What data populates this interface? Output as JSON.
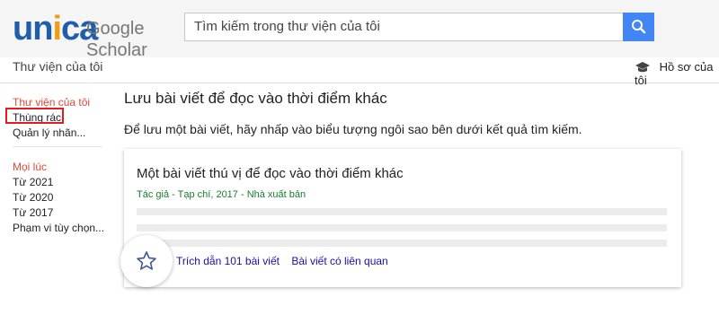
{
  "header": {
    "brand_unica": "unica",
    "brand_scholar": "Google Scholar",
    "search_placeholder": "Tìm kiếm trong thư viện của tôi"
  },
  "subheader": {
    "title": "Thư viện của tôi",
    "profile_label": "Hồ sơ của tôi"
  },
  "sidebar": {
    "library_items": [
      {
        "label": "Thư viện của tôi",
        "active": true
      },
      {
        "label": "Thùng rác",
        "highlighted": true
      },
      {
        "label": "Quản lý nhãn..."
      }
    ],
    "time_items": [
      {
        "label": "Mọi lúc",
        "active": true
      },
      {
        "label": "Từ 2021"
      },
      {
        "label": "Từ 2020"
      },
      {
        "label": "Từ 2017"
      },
      {
        "label": "Phạm vi tùy chọn..."
      }
    ]
  },
  "main": {
    "heading": "Lưu bài viết để đọc vào thời điểm khác",
    "description": "Để lưu một bài viết, hãy nhấp vào biểu tượng ngôi sao bên dưới kết quả tìm kiếm.",
    "example_card": {
      "title": "Một bài viết thú vị để đọc vào thời điểm khác",
      "meta": "Tác giả - Tạp chí, 2017 - Nhà xuất bản",
      "cited_by": "Trích dẫn 101 bài viết",
      "related": "Bài viết có liên quan"
    }
  },
  "colors": {
    "accent_red": "#dd4b39",
    "search_button": "#4285f4",
    "meta_green": "#1a7c2e",
    "link_blue": "#1a0dab",
    "highlight_border": "#e31b23",
    "brand_blue": "#1f5eaa",
    "brand_orange": "#f39c12"
  },
  "icons": {
    "search": "search-icon",
    "profile": "graduation-cap-icon",
    "star": "star-icon",
    "menu": "hamburger-menu-icon"
  }
}
